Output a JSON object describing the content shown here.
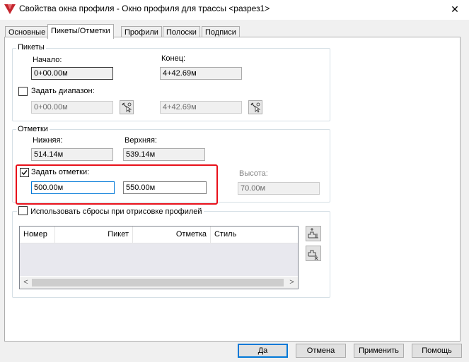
{
  "window": {
    "title": "Свойства окна профиля - Окно профиля для трассы <разрез1>"
  },
  "tabs": [
    "Основные",
    "Пикеты/Отметки",
    "Профили",
    "Полоски",
    "Подписи"
  ],
  "stations": {
    "legend": "Пикеты",
    "start_label": "Начало:",
    "start_value": "0+00.00м",
    "end_label": "Конец:",
    "end_value": "4+42.69м",
    "range_checkbox_label": "Задать диапазон:",
    "range_checked": false,
    "range_start": "0+00.00м",
    "range_end": "4+42.69м"
  },
  "elevations": {
    "legend": "Отметки",
    "lower_label": "Нижняя:",
    "lower_value": "514.14м",
    "upper_label": "Верхняя:",
    "upper_value": "539.14м",
    "set_checkbox_label": "Задать отметки:",
    "set_checked": true,
    "set_min": "500.00м",
    "set_max": "550.00м",
    "height_label": "Высота:",
    "height_value": "70.00м"
  },
  "splits": {
    "checkbox_label": "Использовать сбросы при отрисовке профилей",
    "checked": false,
    "columns": [
      "Номер",
      "Пикет",
      "Отметка",
      "Стиль"
    ],
    "rows": []
  },
  "buttons": {
    "ok": "Да",
    "cancel": "Отмена",
    "apply": "Применить",
    "help": "Помощь"
  },
  "colors": {
    "highlight": "#e8101a",
    "focus": "#0078d7"
  }
}
